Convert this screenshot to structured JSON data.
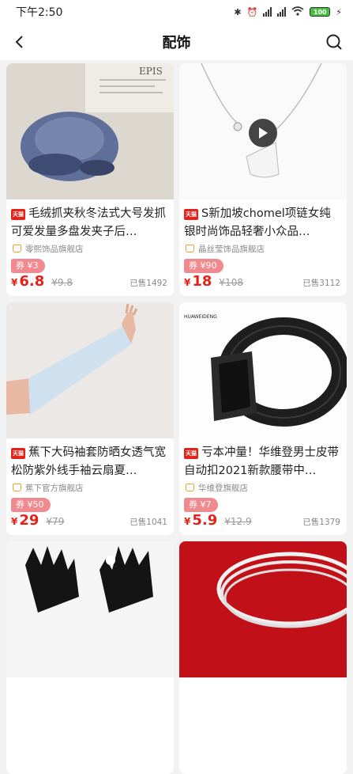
{
  "status": {
    "time": "下午2:50",
    "battery": "100"
  },
  "nav": {
    "title": "配饰"
  },
  "products": [
    {
      "name": "毛绒抓夹秋冬法式大号发抓可爱发量多盘发夹子后…",
      "shop": "零熙饰品旗舰店",
      "coupon": "券 ¥3",
      "price": "6.8",
      "original": "¥9.8",
      "sold": "已售1492",
      "badge": "天猫"
    },
    {
      "name": "S新加坡chomel项链女纯银时尚饰品轻奢小众品…",
      "shop": "晶丝莹饰品旗舰店",
      "coupon": "券 ¥90",
      "price": "18",
      "original": "¥108",
      "sold": "已售3112",
      "badge": "天猫"
    },
    {
      "name": "蕉下大码袖套防晒女透气宽松防紫外线手袖云扇夏…",
      "shop": "蕉下官方旗舰店",
      "coupon": "券 ¥50",
      "price": "29",
      "original": "¥79",
      "sold": "已售1041",
      "badge": "天猫"
    },
    {
      "name": "亏本冲量！华维登男士皮带自动扣2021新款腰带中…",
      "shop": "华维登旗舰店",
      "coupon": "券 ¥7",
      "price": "5.9",
      "original": "¥12.9",
      "sold": "已售1379",
      "badge": "天猫"
    }
  ],
  "images": {
    "brand_text": "HUAWEIDENG",
    "newspaper_text": "EPIS"
  },
  "colors": {
    "price": "#e2231a",
    "coupon": "#f08a8e"
  }
}
